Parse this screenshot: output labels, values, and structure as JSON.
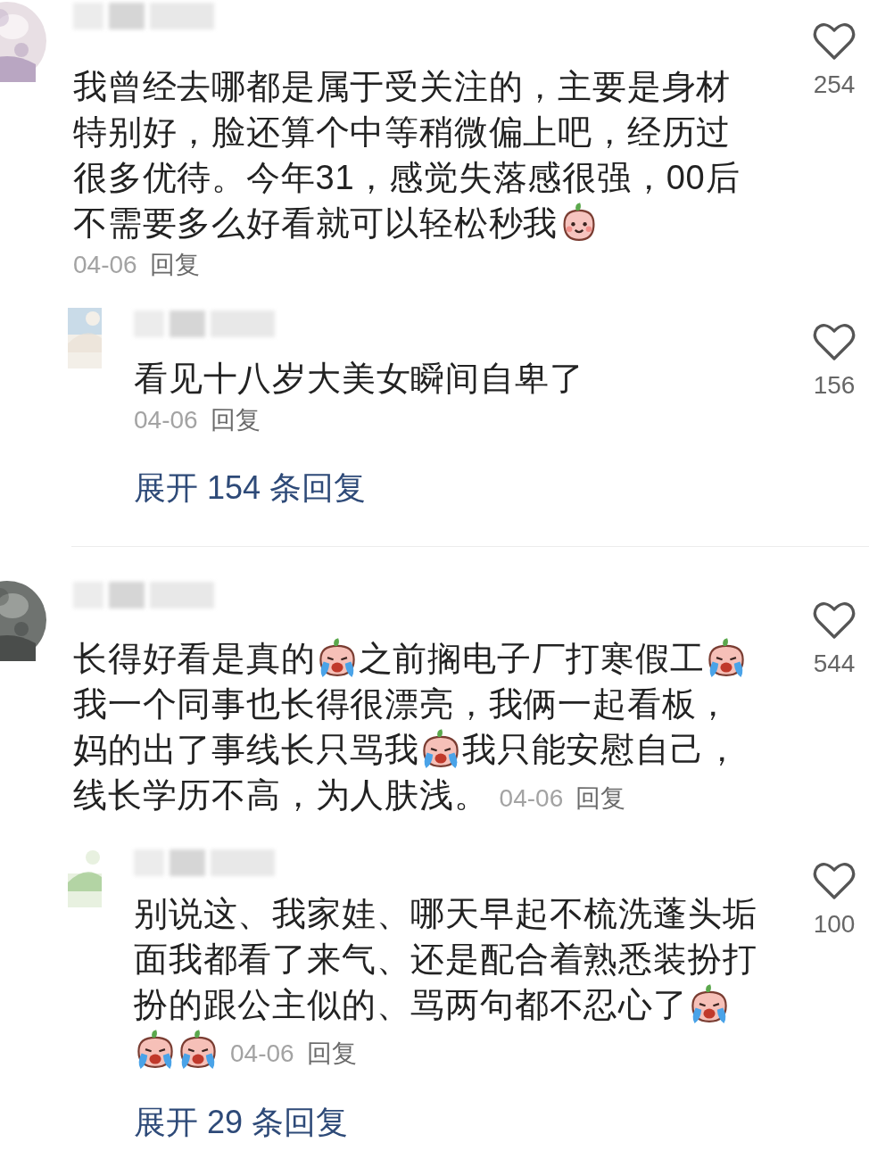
{
  "comments": [
    {
      "parts": [
        {
          "kind": "text",
          "text": "我曾经去哪都是属于受关注的，主要是身材特别好，脸还算个中等稍微偏上吧，经历过很多优待。今年31，感觉失落感很强，00后"
        },
        {
          "kind": "text",
          "text": "不需要多么好看就可以轻松秒我"
        },
        {
          "kind": "smile"
        }
      ],
      "date_inline": false,
      "date": "04-06",
      "reply_label": "回复",
      "likes": "254",
      "replies": [
        {
          "parts": [
            {
              "kind": "text",
              "text": "看见十八岁大美女瞬间自卑了"
            }
          ],
          "date_inline": false,
          "date": "04-06",
          "reply_label": "回复",
          "likes": "156"
        }
      ],
      "expand_label": "展开 154 条回复"
    },
    {
      "parts": [
        {
          "kind": "text",
          "text": "长得好看是真的"
        },
        {
          "kind": "cry"
        },
        {
          "kind": "text",
          "text": "之前搁电子厂打寒假工"
        },
        {
          "kind": "cry"
        },
        {
          "kind": "text",
          "text": "我一个同事也长得很漂亮，我俩一起看板，"
        },
        {
          "kind": "text",
          "text": "妈的出了事线长只骂我"
        },
        {
          "kind": "cry"
        },
        {
          "kind": "text",
          "text": "我只能安慰自己，"
        },
        {
          "kind": "text",
          "text": "线长学历不高，为人肤浅。"
        }
      ],
      "date_inline": true,
      "date": "04-06",
      "reply_label": "回复",
      "likes": "544",
      "replies": [
        {
          "parts": [
            {
              "kind": "text",
              "text": "别说这、我家娃、哪天早起不梳洗蓬头垢面我都看了来气、还是配合着熟悉装扮打"
            },
            {
              "kind": "text",
              "text": "扮的跟公主似的、骂两句都不忍心了"
            },
            {
              "kind": "cry"
            },
            {
              "kind": "cry"
            },
            {
              "kind": "cry"
            }
          ],
          "date_inline": true,
          "date": "04-06",
          "reply_label": "回复",
          "likes": "100"
        }
      ],
      "expand_label": "展开 29 条回复"
    }
  ]
}
